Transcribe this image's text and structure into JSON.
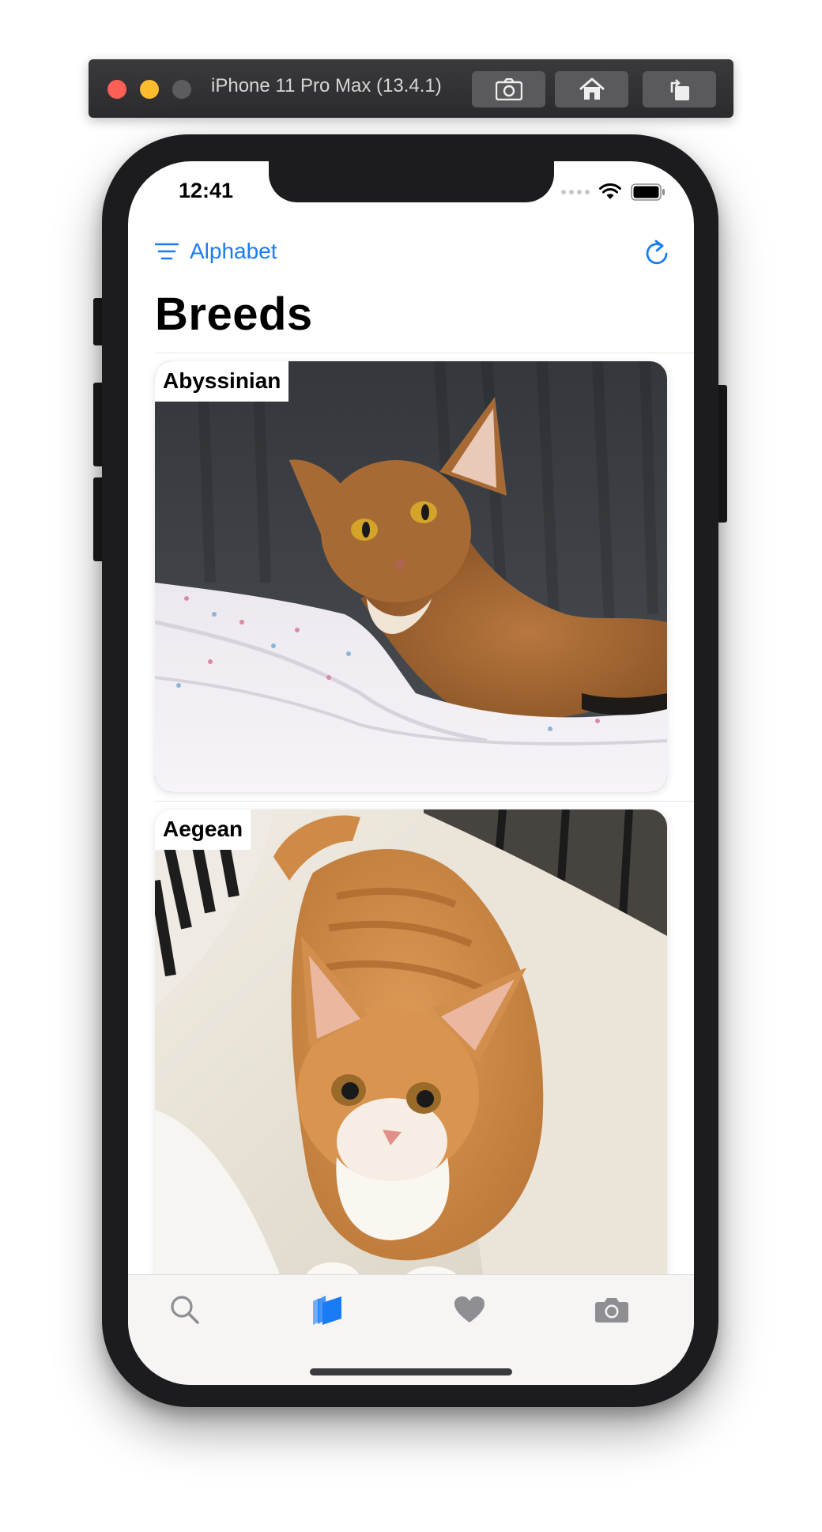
{
  "simulator": {
    "title": "iPhone 11 Pro Max (13.4.1)",
    "buttons": [
      "screenshot-icon",
      "home-icon",
      "rotate-icon"
    ]
  },
  "status_bar": {
    "time": "12:41"
  },
  "nav": {
    "sort_label": "Alphabet",
    "refresh_icon": "refresh-icon"
  },
  "page": {
    "title": "Breeds"
  },
  "breeds": [
    {
      "name": "Abyssinian"
    },
    {
      "name": "Aegean"
    }
  ],
  "tab_bar": {
    "tabs": [
      {
        "icon": "search-icon",
        "selected": false
      },
      {
        "icon": "breeds-icon",
        "selected": true
      },
      {
        "icon": "heart-icon",
        "selected": false
      },
      {
        "icon": "camera-icon",
        "selected": false
      }
    ],
    "accent_color": "#1a7cf5",
    "inactive_color": "#8e8e93"
  }
}
